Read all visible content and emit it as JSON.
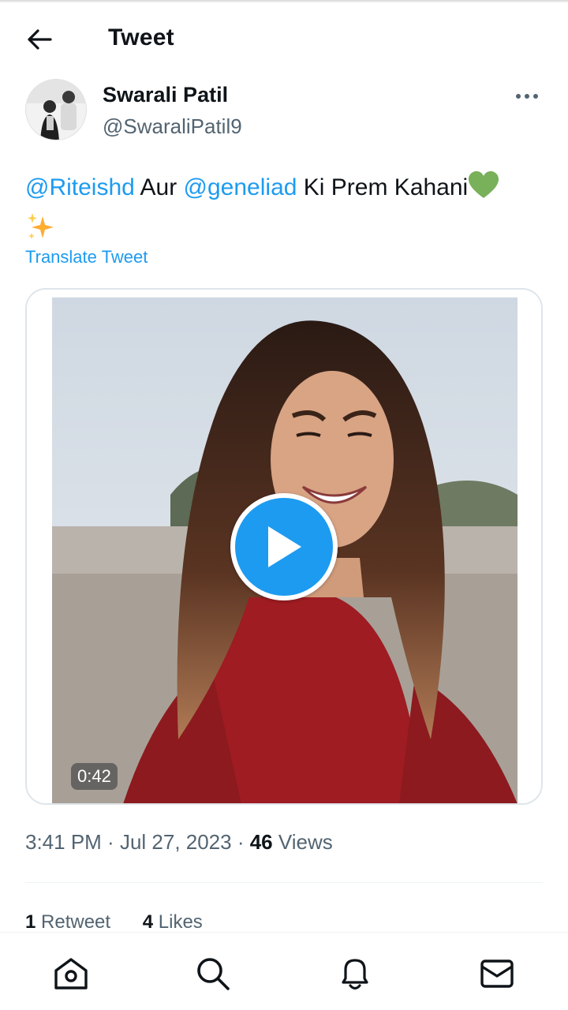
{
  "header": {
    "title": "Tweet",
    "back_icon": "arrow-left-icon"
  },
  "author": {
    "name": "Swarali Patil",
    "handle": "@SwaraliPatil9",
    "more_icon": "more-horizontal-icon"
  },
  "tweet": {
    "mention1": "@Riteishd",
    "text1": " Aur ",
    "mention2": "@geneliad",
    "text2": " Ki Prem Kahani",
    "emojis": [
      "green-heart",
      "sparkles"
    ],
    "translate": "Translate Tweet"
  },
  "media": {
    "duration": "0:42",
    "play_icon": "play-icon"
  },
  "meta": {
    "time": "3:41 PM",
    "sep1": " · ",
    "date": "Jul 27, 2023",
    "sep2": " · ",
    "views_count": "46",
    "views_label": " Views"
  },
  "stats": {
    "retweets_count": "1",
    "retweets_label": " Retweet",
    "likes_count": "4",
    "likes_label": " Likes"
  },
  "tabbar": {
    "items": [
      "home-icon",
      "search-icon",
      "notifications-icon",
      "messages-icon"
    ]
  },
  "colors": {
    "accent": "#1d9bf0",
    "text": "#0f1419",
    "secondary": "#536471",
    "heart": "#78b159",
    "sweater": "#9e1c22"
  }
}
